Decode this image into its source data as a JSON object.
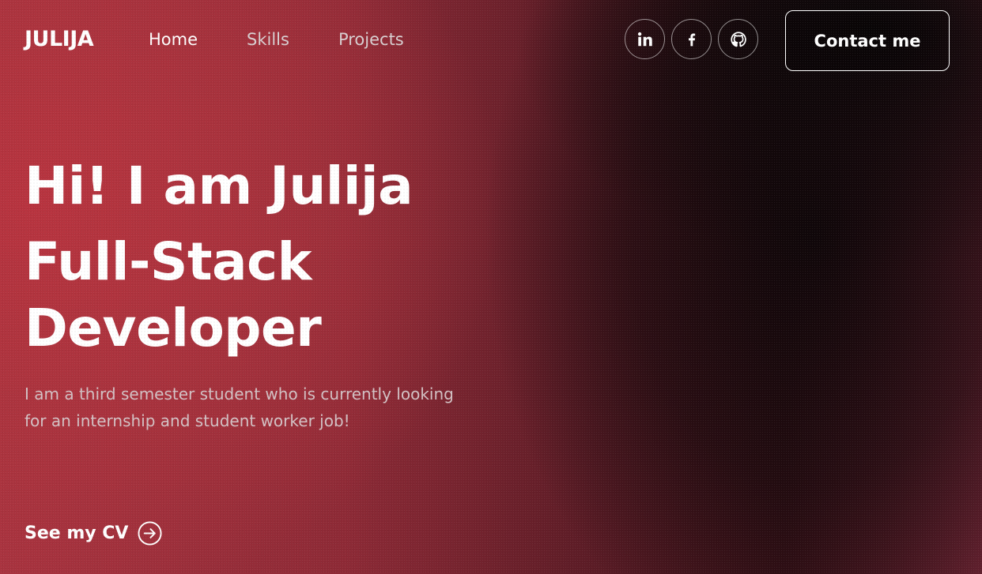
{
  "brand": {
    "logo": "JULIJA"
  },
  "nav": {
    "links": [
      {
        "label": "Home"
      },
      {
        "label": "Skills"
      },
      {
        "label": "Projects"
      }
    ]
  },
  "socials": [
    {
      "name": "linkedin",
      "icon": "linkedin-icon"
    },
    {
      "name": "facebook",
      "icon": "facebook-icon"
    },
    {
      "name": "github",
      "icon": "github-icon"
    }
  ],
  "header": {
    "contact_label": "Contact me"
  },
  "hero": {
    "greeting": "Hi! I am Julija",
    "role_line1": "Full-Stack",
    "role_line2": "Developer",
    "intro": "I am a third semester student who is currently looking for an internship and student worker job!",
    "cv_label": "See my CV",
    "cv_icon": "arrow-right-circle-icon"
  },
  "colors": {
    "accent_red": "#b8343f",
    "dark": "#0c0608",
    "text": "#ffffff",
    "muted_text": "#d4c2c5"
  }
}
